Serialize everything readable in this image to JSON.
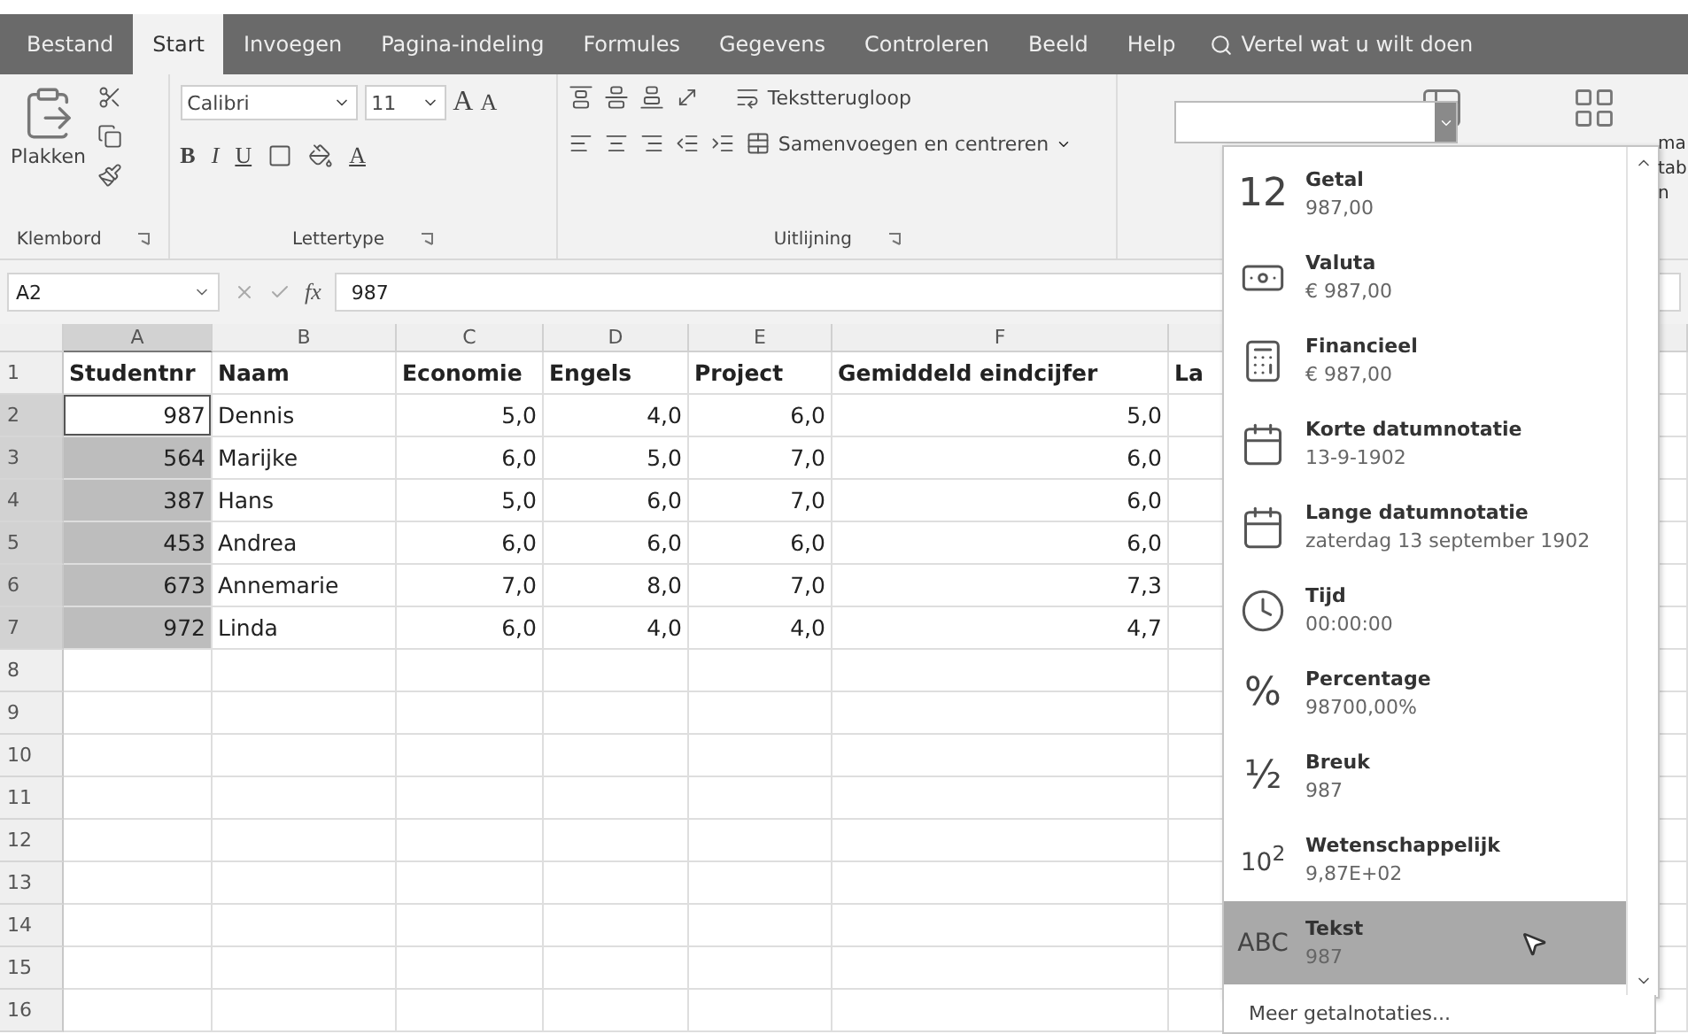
{
  "ribbon_tabs": [
    {
      "label": "Bestand",
      "selected": false
    },
    {
      "label": "Start",
      "selected": true
    },
    {
      "label": "Invoegen",
      "selected": false
    },
    {
      "label": "Pagina-indeling",
      "selected": false
    },
    {
      "label": "Formules",
      "selected": false
    },
    {
      "label": "Gegevens",
      "selected": false
    },
    {
      "label": "Controleren",
      "selected": false
    },
    {
      "label": "Beeld",
      "selected": false
    },
    {
      "label": "Help",
      "selected": false
    }
  ],
  "tell_me": {
    "placeholder": "Vertel wat u wilt doen"
  },
  "clipboard": {
    "paste_label": "Plakken",
    "group_label": "Klembord"
  },
  "font": {
    "name": "Calibri",
    "size": "11",
    "grow": "A",
    "shrink": "A",
    "bold": "B",
    "italic": "I",
    "underline": "U",
    "font_color": "A",
    "group_label": "Lettertype"
  },
  "alignment": {
    "wrap_label": "Tekstterugloop",
    "merge_label": "Samenvoegen en centreren",
    "group_label": "Uitlijning"
  },
  "styles_cut_labels": [
    "ma",
    "tab",
    "n"
  ],
  "formula_bar": {
    "name_box": "A2",
    "fx": "fx",
    "value": "987"
  },
  "sheet": {
    "columns": [
      {
        "label": "A",
        "selected": true
      },
      {
        "label": "B",
        "selected": false
      },
      {
        "label": "C",
        "selected": false
      },
      {
        "label": "D",
        "selected": false
      },
      {
        "label": "E",
        "selected": false
      },
      {
        "label": "F",
        "selected": false
      },
      {
        "selected": false
      }
    ],
    "rows": [
      {
        "number": "1",
        "selected": false,
        "header": true,
        "cells": [
          {
            "text": "Studentnr",
            "selected": false
          },
          {
            "text": "Naam",
            "selected": false
          },
          {
            "text": "Economie",
            "selected": false
          },
          {
            "text": "Engels",
            "selected": false
          },
          {
            "text": "Project",
            "selected": false
          },
          {
            "text": "Gemiddeld eindcijfer",
            "selected": false
          },
          {
            "text": "La",
            "selected": false
          }
        ]
      },
      {
        "number": "2",
        "selected": true,
        "cells": [
          {
            "text": "987",
            "selected": false,
            "active": true
          },
          {
            "text": "Dennis",
            "selected": false
          },
          {
            "text": "5,0",
            "selected": false
          },
          {
            "text": "4,0",
            "selected": false
          },
          {
            "text": "6,0",
            "selected": false
          },
          {
            "text": "5,0",
            "selected": false
          }
        ]
      },
      {
        "number": "3",
        "selected": true,
        "cells": [
          {
            "text": "564",
            "selected": true
          },
          {
            "text": "Marijke",
            "selected": false
          },
          {
            "text": "6,0",
            "selected": false
          },
          {
            "text": "5,0",
            "selected": false
          },
          {
            "text": "7,0",
            "selected": false
          },
          {
            "text": "6,0",
            "selected": false
          }
        ]
      },
      {
        "number": "4",
        "selected": true,
        "cells": [
          {
            "text": "387",
            "selected": true
          },
          {
            "text": "Hans",
            "selected": false
          },
          {
            "text": "5,0",
            "selected": false
          },
          {
            "text": "6,0",
            "selected": false
          },
          {
            "text": "7,0",
            "selected": false
          },
          {
            "text": "6,0",
            "selected": false
          }
        ]
      },
      {
        "number": "5",
        "selected": true,
        "cells": [
          {
            "text": "453",
            "selected": true
          },
          {
            "text": "Andrea",
            "selected": false
          },
          {
            "text": "6,0",
            "selected": false
          },
          {
            "text": "6,0",
            "selected": false
          },
          {
            "text": "6,0",
            "selected": false
          },
          {
            "text": "6,0",
            "selected": false
          }
        ]
      },
      {
        "number": "6",
        "selected": true,
        "cells": [
          {
            "text": "673",
            "selected": true
          },
          {
            "text": "Annemarie",
            "selected": false
          },
          {
            "text": "7,0",
            "selected": false
          },
          {
            "text": "8,0",
            "selected": false
          },
          {
            "text": "7,0",
            "selected": false
          },
          {
            "text": "7,3",
            "selected": false
          }
        ]
      },
      {
        "number": "7",
        "selected": true,
        "cells": [
          {
            "text": "972",
            "selected": true
          },
          {
            "text": "Linda",
            "selected": false
          },
          {
            "text": "6,0",
            "selected": false
          },
          {
            "text": "4,0",
            "selected": false
          },
          {
            "text": "4,0",
            "selected": false
          },
          {
            "text": "4,7",
            "selected": false
          }
        ]
      },
      {
        "number": "8",
        "selected": false
      },
      {
        "number": "9",
        "selected": false
      },
      {
        "number": "10",
        "selected": false
      },
      {
        "number": "11",
        "selected": false
      },
      {
        "number": "12",
        "selected": false
      },
      {
        "number": "13",
        "selected": false
      },
      {
        "number": "14",
        "selected": false
      },
      {
        "number": "15",
        "selected": false
      },
      {
        "number": "16",
        "selected": false
      }
    ]
  },
  "number_format_menu": {
    "items": [
      {
        "kind": "symbol",
        "symbol": "12",
        "name": "Getal",
        "example": "987,00",
        "selected": false
      },
      {
        "kind": "currency",
        "name": "Valuta",
        "example": "€ 987,00",
        "selected": false
      },
      {
        "kind": "financial",
        "name": "Financieel",
        "example": " € 987,00",
        "selected": false
      },
      {
        "kind": "calendar",
        "name": "Korte datumnotatie",
        "example": "13-9-1902",
        "selected": false
      },
      {
        "kind": "calendar",
        "name": "Lange datumnotatie",
        "example": "zaterdag 13 september 1902",
        "selected": false
      },
      {
        "kind": "clock",
        "name": "Tijd",
        "example": "00:00:00",
        "selected": false
      },
      {
        "kind": "symbol",
        "symbol": "%",
        "name": "Percentage",
        "example": "98700,00%",
        "selected": false
      },
      {
        "kind": "symbol",
        "symbol": "½",
        "name": "Breuk",
        "example": "987",
        "selected": false
      },
      {
        "kind": "symbol",
        "symbol": "10$^{2}$",
        "name": "Wetenschappelijk",
        "example": "9,87E+02",
        "selected": false
      },
      {
        "kind": "symbol",
        "symbol": "ABC",
        "name": "Tekst",
        "example": "987",
        "selected": true
      }
    ],
    "more_link": "Meer getalnotaties..."
  }
}
